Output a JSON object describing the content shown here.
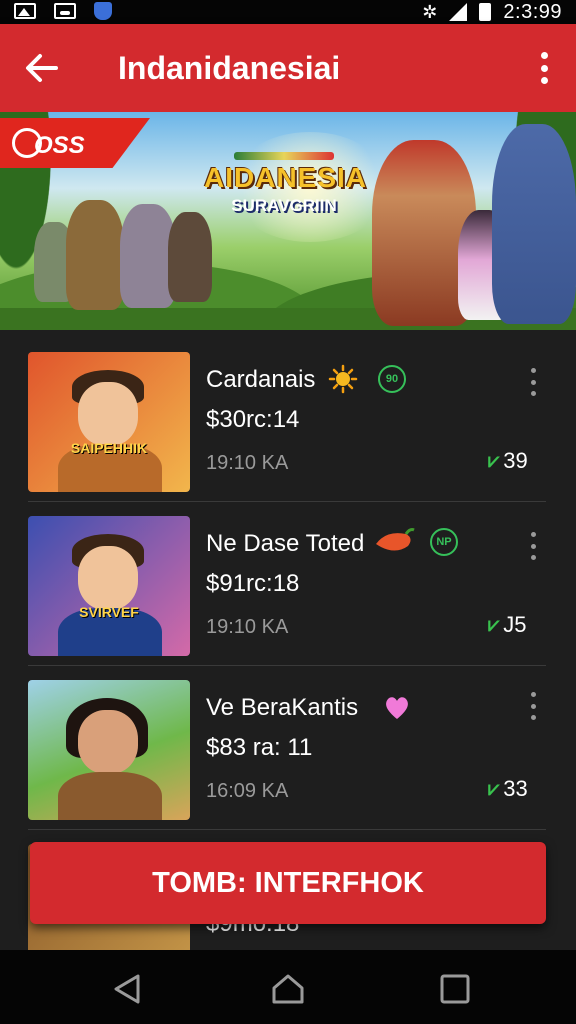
{
  "status_bar": {
    "time": "2:3:99",
    "icons": [
      "gallery-icon",
      "device-icon",
      "shield-icon",
      "gear-icon",
      "signal-icon",
      "battery-icon"
    ]
  },
  "app_bar": {
    "title": "Indanidanesiai",
    "back_icon": "arrow-left-icon",
    "menu_icon": "more-vertical-icon"
  },
  "banner": {
    "ribbon_text": "OSS",
    "logo_title": "AIDANESIA",
    "logo_subtitle": "SURAVGRIIN"
  },
  "items": [
    {
      "title": "Cardanais",
      "price": "$30rc:14",
      "time": "19:10 KA",
      "count": "39",
      "ring_badge": "90",
      "emoji": "sun-icon",
      "thumb_label": "SAIPEHHIK",
      "thumb_colors": [
        "#e0552c",
        "#f2b64c"
      ]
    },
    {
      "title": "Ne Dase Toted",
      "price": "$91rc:18",
      "time": "19:10 KA",
      "count": "J5",
      "ring_badge": "NP",
      "emoji": "pepper-icon",
      "thumb_label": "SVIRVEF",
      "thumb_colors": [
        "#3c4fb0",
        "#d46aa8"
      ]
    },
    {
      "title": "Ve BeraKantis",
      "price": "$83 ra: 11",
      "time": "16:09 KA",
      "count": "33",
      "ring_badge": "",
      "emoji": "heart-icon",
      "thumb_label": "",
      "thumb_colors": [
        "#6fb84a",
        "#d9a45a"
      ]
    },
    {
      "title": "",
      "price": "$9mo:18",
      "time": "",
      "count": "",
      "ring_badge": "",
      "emoji": "",
      "thumb_label": "",
      "thumb_colors": [
        "#8a5a2a",
        "#c99a4a"
      ]
    }
  ],
  "cta": {
    "label": "TOMB: INTERFHOK"
  },
  "nav_bar": {
    "buttons": [
      "back-triangle-icon",
      "home-icon",
      "recents-icon"
    ]
  }
}
